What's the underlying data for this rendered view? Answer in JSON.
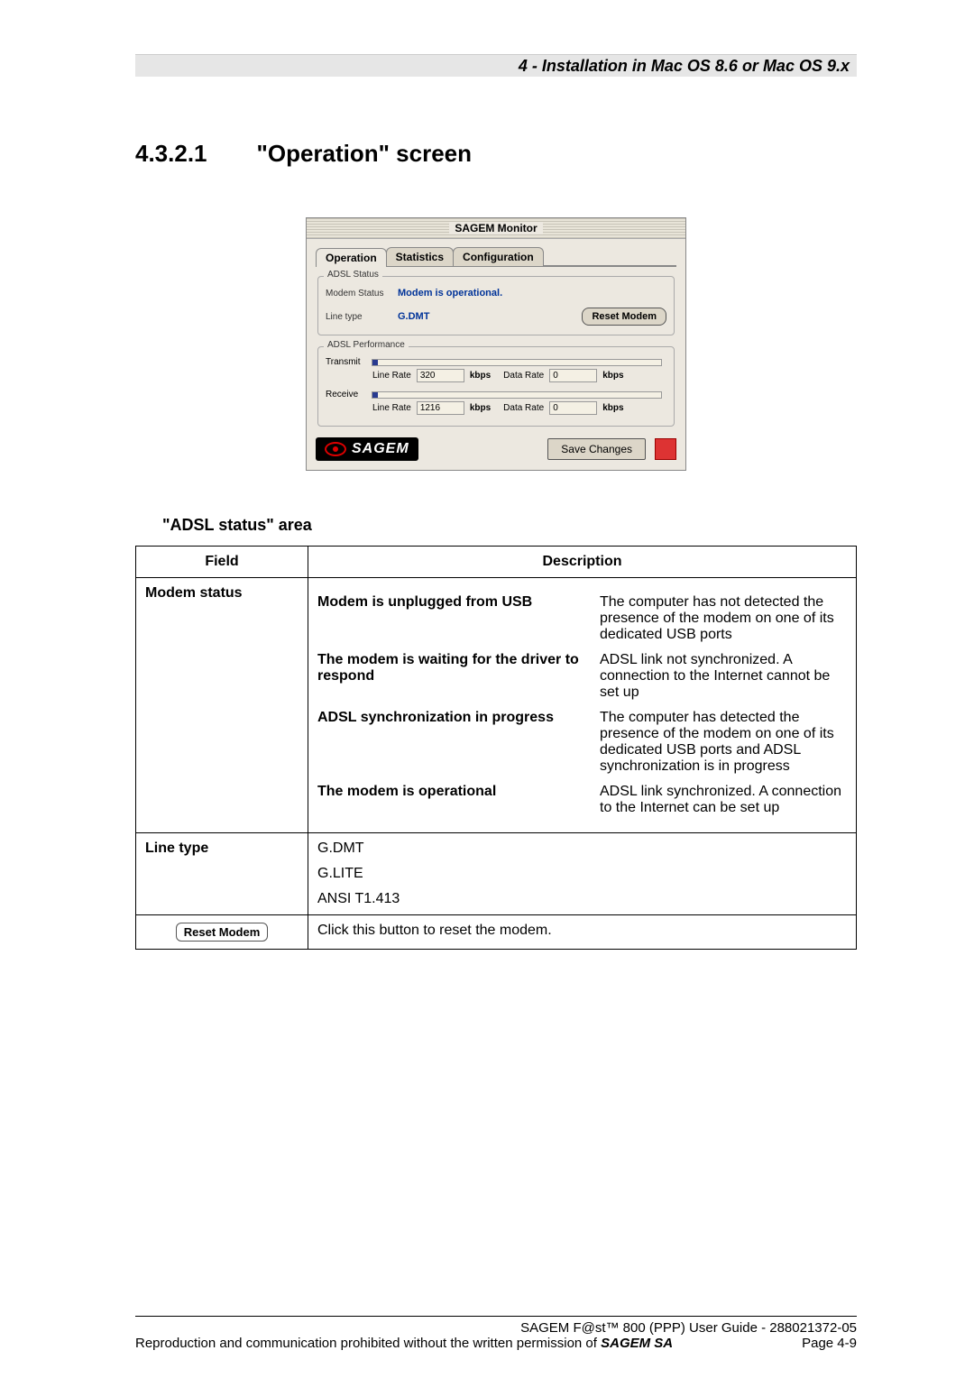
{
  "header": {
    "chapter_title": "4 - Installation in Mac OS 8.6 or Mac OS 9.x"
  },
  "section": {
    "number": "4.3.2.1",
    "title": "\"Operation\" screen"
  },
  "monitor": {
    "window_title": "SAGEM Monitor",
    "tabs": {
      "operation": "Operation",
      "statistics": "Statistics",
      "configuration": "Configuration"
    },
    "adsl_status_legend": "ADSL Status",
    "modem_status_label": "Modem Status",
    "modem_status_value": "Modem is operational.",
    "line_type_label": "Line type",
    "line_type_value": "G.DMT",
    "reset_button": "Reset Modem",
    "perf_legend": "ADSL Performance",
    "transmit_label": "Transmit",
    "receive_label": "Receive",
    "line_rate_label": "Line Rate",
    "data_rate_label": "Data Rate",
    "kbps_label": "kbps",
    "transmit_line_rate": "320",
    "transmit_data_rate": "0",
    "receive_line_rate": "1216",
    "receive_data_rate": "0",
    "logo_text": "SAGEM",
    "save_button": "Save Changes"
  },
  "area_title": "\"ADSL status\" area",
  "table": {
    "headers": {
      "field": "Field",
      "description": "Description"
    },
    "row1": {
      "field": "Modem status",
      "sub1_label": "Modem is unplugged from USB",
      "sub1_text": "The computer has not detected the presence of the modem on one of its dedicated USB ports",
      "sub2_label": "The modem is waiting for the driver to respond",
      "sub2_text": "ADSL link not synchronized.  A connection to the Internet cannot be set up",
      "sub3_label": "ADSL synchronization in progress",
      "sub3_text": "The computer has detected the presence of the modem on one of its dedicated USB ports and ADSL synchronization is in progress",
      "sub4_label": "The modem is operational",
      "sub4_text": "ADSL link synchronized.  A connection to the Internet can be set up"
    },
    "row2": {
      "field": "Line type",
      "value1": "G.DMT",
      "value2": "G.LITE",
      "value3": "ANSI T1.413"
    },
    "row3": {
      "button_label": "Reset Modem",
      "text": "Click this button to reset the modem."
    }
  },
  "footer": {
    "line1": "SAGEM F@st™ 800 (PPP) User Guide - 288021372-05",
    "line2_left": "Reproduction and communication prohibited without the written permission of ",
    "line2_brand": "SAGEM SA",
    "page": "Page 4-9"
  }
}
